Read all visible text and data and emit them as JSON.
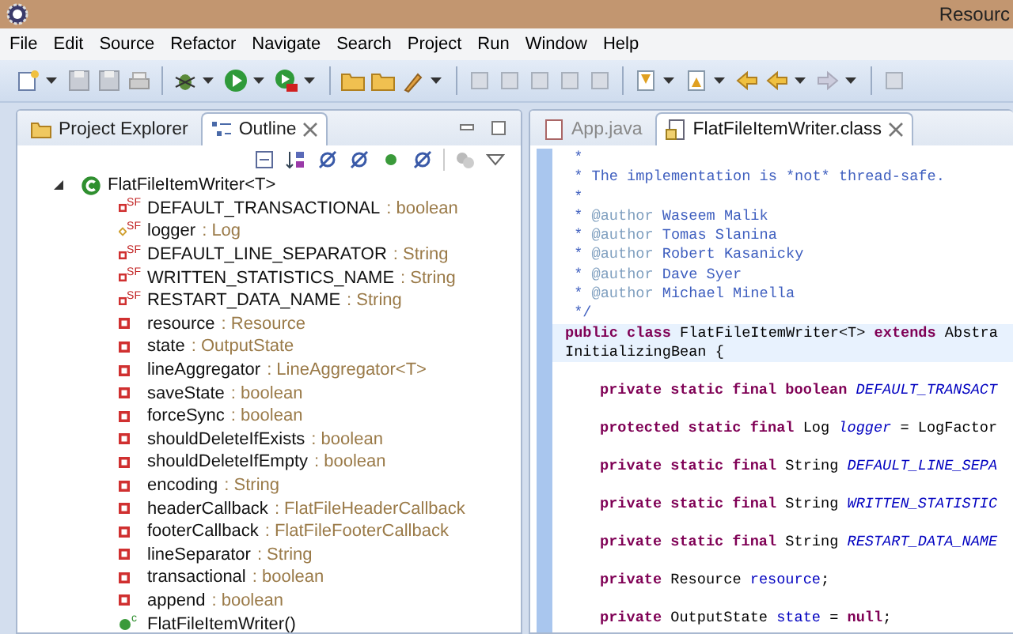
{
  "window": {
    "title": "Resourc"
  },
  "menu": [
    {
      "label": "File"
    },
    {
      "label": "Edit"
    },
    {
      "label": "Source"
    },
    {
      "label": "Refactor"
    },
    {
      "label": "Navigate"
    },
    {
      "label": "Search"
    },
    {
      "label": "Project"
    },
    {
      "label": "Run"
    },
    {
      "label": "Window"
    },
    {
      "label": "Help"
    }
  ],
  "left_tabs": [
    {
      "label": "Project Explorer",
      "selected": false,
      "kind": "explorer"
    },
    {
      "label": "Outline",
      "selected": true,
      "kind": "outline"
    }
  ],
  "outline": {
    "root": {
      "name": "FlatFileItemWriter<T>",
      "expanded": true,
      "children": [
        {
          "kind": "static-final",
          "badge": "SF",
          "name": "DEFAULT_TRANSACTIONAL",
          "type": ": boolean"
        },
        {
          "kind": "protected-static-final",
          "badge": "SF",
          "name": "logger",
          "type": ": Log"
        },
        {
          "kind": "static-final",
          "badge": "SF",
          "name": "DEFAULT_LINE_SEPARATOR",
          "type": ": String"
        },
        {
          "kind": "static-final",
          "badge": "SF",
          "name": "WRITTEN_STATISTICS_NAME",
          "type": ": String"
        },
        {
          "kind": "static-final",
          "badge": "SF",
          "name": "RESTART_DATA_NAME",
          "type": ": String"
        },
        {
          "kind": "field",
          "name": "resource",
          "type": ": Resource"
        },
        {
          "kind": "field",
          "name": "state",
          "type": ": OutputState"
        },
        {
          "kind": "field",
          "name": "lineAggregator",
          "type": ": LineAggregator<T>"
        },
        {
          "kind": "field",
          "name": "saveState",
          "type": ": boolean"
        },
        {
          "kind": "field",
          "name": "forceSync",
          "type": ": boolean"
        },
        {
          "kind": "field",
          "name": "shouldDeleteIfExists",
          "type": ": boolean"
        },
        {
          "kind": "field",
          "name": "shouldDeleteIfEmpty",
          "type": ": boolean"
        },
        {
          "kind": "field",
          "name": "encoding",
          "type": ": String"
        },
        {
          "kind": "field",
          "name": "headerCallback",
          "type": ": FlatFileHeaderCallback"
        },
        {
          "kind": "field",
          "name": "footerCallback",
          "type": ": FlatFileFooterCallback"
        },
        {
          "kind": "field",
          "name": "lineSeparator",
          "type": ": String"
        },
        {
          "kind": "field",
          "name": "transactional",
          "type": ": boolean"
        },
        {
          "kind": "field",
          "name": "append",
          "type": ": boolean"
        },
        {
          "kind": "constructor",
          "badge": "c",
          "name": "FlatFileItemWriter()"
        }
      ]
    }
  },
  "editor_tabs": [
    {
      "label": "App.java",
      "selected": false,
      "kind": "java"
    },
    {
      "label": "FlatFileItemWriter.class",
      "selected": true,
      "kind": "class"
    }
  ],
  "code": [
    {
      "spaced": false,
      "highlighted": false,
      "tokens": [
        {
          "kind": "comment",
          "text": " *"
        }
      ]
    },
    {
      "spaced": false,
      "highlighted": false,
      "tokens": [
        {
          "kind": "comment",
          "text": " * The implementation is *not* thread-safe."
        }
      ]
    },
    {
      "spaced": false,
      "highlighted": false,
      "tokens": [
        {
          "kind": "comment",
          "text": " *"
        }
      ]
    },
    {
      "spaced": false,
      "highlighted": false,
      "tokens": [
        {
          "kind": "comment",
          "text": " * "
        },
        {
          "kind": "tag",
          "text": "@author"
        },
        {
          "kind": "comment",
          "text": " Waseem Malik"
        }
      ]
    },
    {
      "spaced": false,
      "highlighted": false,
      "tokens": [
        {
          "kind": "comment",
          "text": " * "
        },
        {
          "kind": "tag",
          "text": "@author"
        },
        {
          "kind": "comment",
          "text": " Tomas Slanina"
        }
      ]
    },
    {
      "spaced": false,
      "highlighted": false,
      "tokens": [
        {
          "kind": "comment",
          "text": " * "
        },
        {
          "kind": "tag",
          "text": "@author"
        },
        {
          "kind": "comment",
          "text": " Robert Kasanicky"
        }
      ]
    },
    {
      "spaced": false,
      "highlighted": false,
      "tokens": [
        {
          "kind": "comment",
          "text": " * "
        },
        {
          "kind": "tag",
          "text": "@author"
        },
        {
          "kind": "comment",
          "text": " Dave Syer"
        }
      ]
    },
    {
      "spaced": false,
      "highlighted": false,
      "tokens": [
        {
          "kind": "comment",
          "text": " * "
        },
        {
          "kind": "tag",
          "text": "@author"
        },
        {
          "kind": "comment",
          "text": " Michael Minella"
        }
      ]
    },
    {
      "spaced": false,
      "highlighted": false,
      "tokens": [
        {
          "kind": "comment",
          "text": " */"
        }
      ]
    },
    {
      "spaced": false,
      "highlighted": true,
      "tokens": [
        {
          "kind": "keyword",
          "text": "public class"
        },
        {
          "kind": "plain",
          "text": " FlatFileItemWriter<T> "
        },
        {
          "kind": "keyword",
          "text": "extends"
        },
        {
          "kind": "plain",
          "text": " Abstra"
        }
      ]
    },
    {
      "spaced": false,
      "highlighted": true,
      "tokens": [
        {
          "kind": "plain",
          "text": "InitializingBean {"
        }
      ]
    },
    {
      "spaced": true,
      "highlighted": false,
      "indented": true,
      "tokens": [
        {
          "kind": "keyword",
          "text": "private static final boolean"
        },
        {
          "kind": "static",
          "text": " DEFAULT_TRANSACT"
        }
      ]
    },
    {
      "spaced": true,
      "highlighted": false,
      "indented": true,
      "tokens": [
        {
          "kind": "keyword",
          "text": "protected static final"
        },
        {
          "kind": "plain",
          "text": " Log "
        },
        {
          "kind": "static",
          "text": "logger"
        },
        {
          "kind": "plain",
          "text": " = LogFactor"
        }
      ]
    },
    {
      "spaced": true,
      "highlighted": false,
      "indented": true,
      "tokens": [
        {
          "kind": "keyword",
          "text": "private static final"
        },
        {
          "kind": "plain",
          "text": " String "
        },
        {
          "kind": "static",
          "text": "DEFAULT_LINE_SEPA"
        }
      ]
    },
    {
      "spaced": true,
      "highlighted": false,
      "indented": true,
      "tokens": [
        {
          "kind": "keyword",
          "text": "private static final"
        },
        {
          "kind": "plain",
          "text": " String "
        },
        {
          "kind": "static",
          "text": "WRITTEN_STATISTIC"
        }
      ]
    },
    {
      "spaced": true,
      "highlighted": false,
      "indented": true,
      "tokens": [
        {
          "kind": "keyword",
          "text": "private static final"
        },
        {
          "kind": "plain",
          "text": " String "
        },
        {
          "kind": "static",
          "text": "RESTART_DATA_NAME"
        }
      ]
    },
    {
      "spaced": true,
      "highlighted": false,
      "indented": true,
      "tokens": [
        {
          "kind": "keyword",
          "text": "private"
        },
        {
          "kind": "plain",
          "text": " Resource "
        },
        {
          "kind": "field",
          "text": "resource"
        },
        {
          "kind": "plain",
          "text": ";"
        }
      ]
    },
    {
      "spaced": true,
      "highlighted": false,
      "indented": true,
      "tokens": [
        {
          "kind": "keyword",
          "text": "private"
        },
        {
          "kind": "plain",
          "text": " OutputState "
        },
        {
          "kind": "field",
          "text": "state"
        },
        {
          "kind": "plain",
          "text": " = "
        },
        {
          "kind": "keyword",
          "text": "null"
        },
        {
          "kind": "plain",
          "text": ";"
        }
      ]
    }
  ]
}
